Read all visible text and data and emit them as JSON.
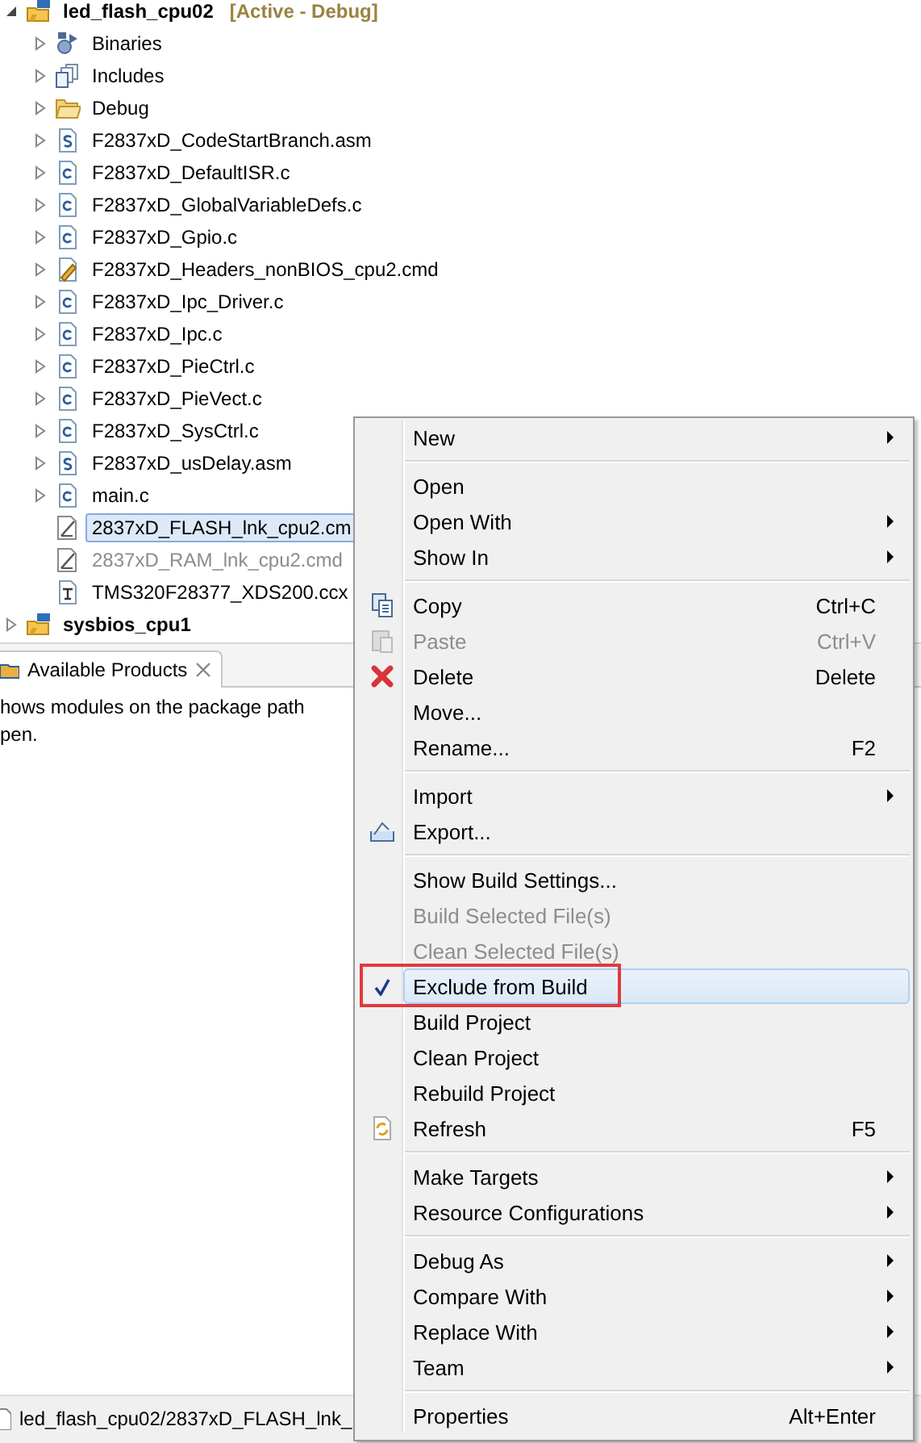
{
  "project_explorer": {
    "items": [
      {
        "label": "led_flash_cpu02",
        "decoration": "[Active - Debug]",
        "kind": "project",
        "expanded": true,
        "selected": false,
        "excluded": false,
        "children": [
          {
            "label": "Binaries",
            "kind": "binaries",
            "expanded": false,
            "selected": false,
            "excluded": false
          },
          {
            "label": "Includes",
            "kind": "includes",
            "expanded": false,
            "selected": false,
            "excluded": false
          },
          {
            "label": "Debug",
            "kind": "folder",
            "expanded": false,
            "selected": false,
            "excluded": false
          },
          {
            "label": "F2837xD_CodeStartBranch.asm",
            "kind": "asm",
            "expanded": false,
            "selected": false,
            "excluded": false
          },
          {
            "label": "F2837xD_DefaultISR.c",
            "kind": "c",
            "expanded": false,
            "selected": false,
            "excluded": false
          },
          {
            "label": "F2837xD_GlobalVariableDefs.c",
            "kind": "c",
            "expanded": false,
            "selected": false,
            "excluded": false
          },
          {
            "label": "F2837xD_Gpio.c",
            "kind": "c",
            "expanded": false,
            "selected": false,
            "excluded": false
          },
          {
            "label": "F2837xD_Headers_nonBIOS_cpu2.cmd",
            "kind": "cmd",
            "expanded": false,
            "selected": false,
            "excluded": false
          },
          {
            "label": "F2837xD_Ipc_Driver.c",
            "kind": "c",
            "expanded": false,
            "selected": false,
            "excluded": false
          },
          {
            "label": "F2837xD_Ipc.c",
            "kind": "c",
            "expanded": false,
            "selected": false,
            "excluded": false
          },
          {
            "label": "F2837xD_PieCtrl.c",
            "kind": "c",
            "expanded": false,
            "selected": false,
            "excluded": false
          },
          {
            "label": "F2837xD_PieVect.c",
            "kind": "c",
            "expanded": false,
            "selected": false,
            "excluded": false
          },
          {
            "label": "F2837xD_SysCtrl.c",
            "kind": "c",
            "expanded": false,
            "selected": false,
            "excluded": false
          },
          {
            "label": "F2837xD_usDelay.asm",
            "kind": "asm",
            "expanded": false,
            "selected": false,
            "excluded": false
          },
          {
            "label": "main.c",
            "kind": "c",
            "expanded": false,
            "selected": false,
            "excluded": false
          },
          {
            "label": "2837xD_FLASH_lnk_cpu2.cm",
            "kind": "linker",
            "selected": true,
            "excluded": false
          },
          {
            "label": "2837xD_RAM_lnk_cpu2.cmd",
            "kind": "linker",
            "selected": false,
            "excluded": true
          },
          {
            "label": "TMS320F28377_XDS200.ccx",
            "kind": "ccxml",
            "selected": false,
            "excluded": false
          }
        ]
      },
      {
        "label": "sysbios_cpu1",
        "kind": "project",
        "expanded": false,
        "selected": false,
        "excluded": false
      }
    ]
  },
  "products_view": {
    "tab": "Available Products",
    "lines": [
      "hows modules on the package path",
      "pen."
    ]
  },
  "context_menu": [
    {
      "kind": "item",
      "label": "New",
      "submenu": true,
      "disabled": false,
      "checked": false,
      "selected": false
    },
    {
      "kind": "separator"
    },
    {
      "kind": "item",
      "label": "Open",
      "submenu": false,
      "disabled": false,
      "checked": false,
      "selected": false
    },
    {
      "kind": "item",
      "label": "Open With",
      "submenu": true,
      "disabled": false,
      "checked": false,
      "selected": false
    },
    {
      "kind": "item",
      "label": "Show In",
      "submenu": true,
      "disabled": false,
      "checked": false,
      "selected": false
    },
    {
      "kind": "separator"
    },
    {
      "kind": "copy",
      "label": "Copy",
      "shortcut": "Ctrl+C",
      "submenu": false,
      "disabled": false,
      "checked": false,
      "selected": false
    },
    {
      "kind": "paste",
      "label": "Paste",
      "shortcut": "Ctrl+V",
      "submenu": false,
      "disabled": true,
      "checked": false,
      "selected": false
    },
    {
      "kind": "delete",
      "label": "Delete",
      "shortcut": "Delete",
      "submenu": false,
      "disabled": false,
      "checked": false,
      "selected": false
    },
    {
      "kind": "item",
      "label": "Move...",
      "submenu": false,
      "disabled": false,
      "checked": false,
      "selected": false
    },
    {
      "kind": "item",
      "label": "Rename...",
      "shortcut": "F2",
      "submenu": false,
      "disabled": false,
      "checked": false,
      "selected": false
    },
    {
      "kind": "separator"
    },
    {
      "kind": "item",
      "label": "Import",
      "submenu": true,
      "disabled": false,
      "checked": false,
      "selected": false
    },
    {
      "kind": "export",
      "label": "Export...",
      "submenu": false,
      "disabled": false,
      "checked": false,
      "selected": false
    },
    {
      "kind": "separator"
    },
    {
      "kind": "item",
      "label": "Show Build Settings...",
      "submenu": false,
      "disabled": false,
      "checked": false,
      "selected": false
    },
    {
      "kind": "item",
      "label": "Build Selected File(s)",
      "submenu": false,
      "disabled": true,
      "checked": false,
      "selected": false
    },
    {
      "kind": "item",
      "label": "Clean Selected File(s)",
      "submenu": false,
      "disabled": true,
      "checked": false,
      "selected": false
    },
    {
      "kind": "item",
      "label": "Exclude from Build",
      "submenu": false,
      "disabled": false,
      "checked": true,
      "selected": true,
      "annotated": true
    },
    {
      "kind": "item",
      "label": "Build Project",
      "submenu": false,
      "disabled": false,
      "checked": false,
      "selected": false
    },
    {
      "kind": "item",
      "label": "Clean Project",
      "submenu": false,
      "disabled": false,
      "checked": false,
      "selected": false
    },
    {
      "kind": "item",
      "label": "Rebuild Project",
      "submenu": false,
      "disabled": false,
      "checked": false,
      "selected": false
    },
    {
      "kind": "refresh",
      "label": "Refresh",
      "shortcut": "F5",
      "submenu": false,
      "disabled": false,
      "checked": false,
      "selected": false
    },
    {
      "kind": "separator"
    },
    {
      "kind": "item",
      "label": "Make Targets",
      "submenu": true,
      "disabled": false,
      "checked": false,
      "selected": false
    },
    {
      "kind": "item",
      "label": "Resource Configurations",
      "submenu": true,
      "disabled": false,
      "checked": false,
      "selected": false
    },
    {
      "kind": "separator"
    },
    {
      "kind": "item",
      "label": "Debug As",
      "submenu": true,
      "disabled": false,
      "checked": false,
      "selected": false
    },
    {
      "kind": "item",
      "label": "Compare With",
      "submenu": true,
      "disabled": false,
      "checked": false,
      "selected": false
    },
    {
      "kind": "item",
      "label": "Replace With",
      "submenu": true,
      "disabled": false,
      "checked": false,
      "selected": false
    },
    {
      "kind": "item",
      "label": "Team",
      "submenu": true,
      "disabled": false,
      "checked": false,
      "selected": false
    },
    {
      "kind": "separator"
    },
    {
      "kind": "item",
      "label": "Properties",
      "shortcut": "Alt+Enter",
      "submenu": false,
      "disabled": false,
      "checked": false,
      "selected": false
    }
  ],
  "status_bar": {
    "path": "led_flash_cpu02/2837xD_FLASH_lnk_"
  }
}
